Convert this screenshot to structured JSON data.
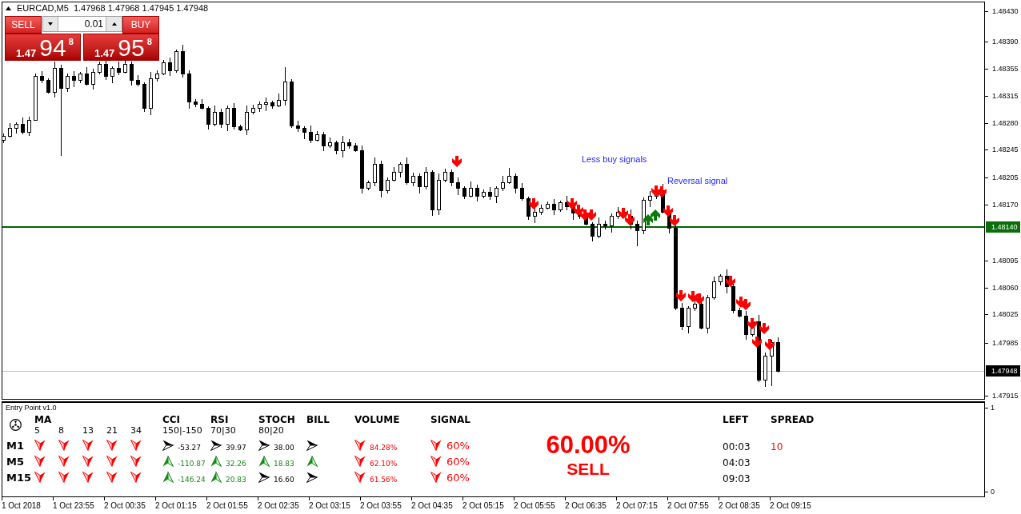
{
  "chart": {
    "title": "EURCAD,M5  1.47968 1.47968 1.47945 1.47948",
    "annotations": [
      "Less buy signals",
      "Reversal signal"
    ]
  },
  "trade_panel": {
    "sell_label": "SELL",
    "lot": "0.01",
    "buy_label": "BUY",
    "sell_price": {
      "prefix": "1.47",
      "main": "94",
      "superscript": "8"
    },
    "buy_price": {
      "prefix": "1.47",
      "main": "95",
      "superscript": "8"
    }
  },
  "price_axis": {
    "labels": [
      "1.48430",
      "1.48390",
      "1.48355",
      "1.48315",
      "1.48280",
      "1.48245",
      "1.48205",
      "1.48170",
      "1.48095",
      "1.48060",
      "1.48025",
      "1.47985",
      "1.47915"
    ],
    "level_label": "1.48140",
    "bid_label": "1.47948"
  },
  "indicator_panel": {
    "title": "Entry Point v1.0",
    "ma": {
      "label": "MA",
      "periods": [
        "5",
        "8",
        "13",
        "21",
        "34"
      ]
    },
    "columns": [
      {
        "label": "CCI",
        "levels": "150|-150"
      },
      {
        "label": "RSI",
        "levels": "70|30"
      },
      {
        "label": "STOCH",
        "levels": "80|20"
      },
      {
        "label": "BILL"
      },
      {
        "label": "VOLUME"
      },
      {
        "label": "SIGNAL"
      }
    ],
    "rows": [
      {
        "timeframe": "M1",
        "ma": [
          {
            "kind": "down"
          },
          {
            "kind": "down"
          },
          {
            "kind": "down"
          },
          {
            "kind": "down"
          },
          {
            "kind": "down"
          }
        ],
        "cells": [
          {
            "kind": "right",
            "value": "-53.27"
          },
          {
            "kind": "right",
            "value": "39.97"
          },
          {
            "kind": "right",
            "value": "38.00"
          },
          {
            "kind": "right"
          },
          {
            "kind": "down",
            "value": "84.28%"
          },
          {
            "kind": "down",
            "value": "60%"
          }
        ]
      },
      {
        "timeframe": "M5",
        "ma": [
          {
            "kind": "down"
          },
          {
            "kind": "down"
          },
          {
            "kind": "down"
          },
          {
            "kind": "down"
          },
          {
            "kind": "down"
          }
        ],
        "cells": [
          {
            "kind": "up",
            "value": "-110.87"
          },
          {
            "kind": "up",
            "value": "32.26"
          },
          {
            "kind": "up",
            "value": "18.83"
          },
          {
            "kind": "up"
          },
          {
            "kind": "down",
            "value": "62.10%"
          },
          {
            "kind": "down",
            "value": "60%"
          }
        ]
      },
      {
        "timeframe": "M15",
        "ma": [
          {
            "kind": "down"
          },
          {
            "kind": "down"
          },
          {
            "kind": "down"
          },
          {
            "kind": "down"
          },
          {
            "kind": "down"
          }
        ],
        "cells": [
          {
            "kind": "up",
            "value": "-146.24"
          },
          {
            "kind": "up",
            "value": "20.83"
          },
          {
            "kind": "right",
            "value": "16.60"
          },
          {
            "kind": "right"
          },
          {
            "kind": "down",
            "value": "61.56%"
          },
          {
            "kind": "down",
            "value": "60%"
          }
        ]
      }
    ],
    "summary": {
      "percent": "60.00%",
      "action": "SELL",
      "kind": "down"
    },
    "timer": {
      "label": "LEFT",
      "values": [
        "00:03",
        "04:03",
        "09:03"
      ]
    },
    "spread": {
      "label": "SPREAD",
      "value": "10"
    }
  },
  "indicator_axis": {
    "labels": [
      "1",
      "0"
    ]
  },
  "time_axis": {
    "labels": [
      "1 Oct 2018",
      "1 Oct 23:55",
      "2 Oct 00:35",
      "2 Oct 01:15",
      "2 Oct 01:55",
      "2 Oct 02:35",
      "2 Oct 03:15",
      "2 Oct 03:55",
      "2 Oct 04:35",
      "2 Oct 05:15",
      "2 Oct 05:55",
      "2 Oct 06:35",
      "2 Oct 07:15",
      "2 Oct 07:55",
      "2 Oct 08:35",
      "2 Oct 09:15"
    ]
  }
}
